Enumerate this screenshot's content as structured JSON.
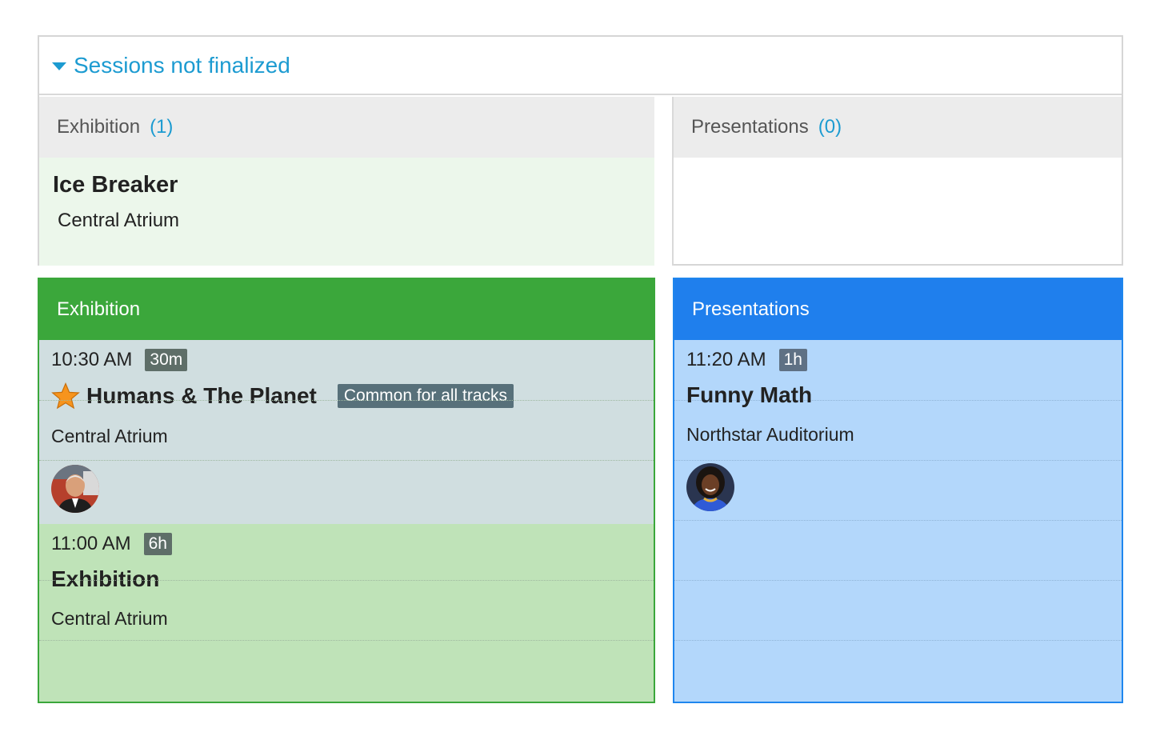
{
  "unfinalized": {
    "title": "Sessions not finalized",
    "tracks": [
      {
        "name": "Exhibition",
        "count": "(1)"
      },
      {
        "name": "Presentations",
        "count": "(0)"
      }
    ],
    "sessions": [
      {
        "title": "Ice Breaker",
        "room": "Central Atrium"
      }
    ]
  },
  "schedule": {
    "tracks": [
      {
        "name": "Exhibition",
        "color": "#3ba73b",
        "sessions": [
          {
            "time": "10:30 AM",
            "duration": "30m",
            "title": "Humans & The Planet",
            "badge": "Common for all tracks",
            "room": "Central Atrium",
            "starred": true,
            "icon": "star-icon"
          },
          {
            "time": "11:00 AM",
            "duration": "6h",
            "title": "Exhibition",
            "room": "Central Atrium"
          }
        ]
      },
      {
        "name": "Presentations",
        "color": "#1f7fed",
        "sessions": [
          {
            "time": "11:20 AM",
            "duration": "1h",
            "title": "Funny Math",
            "room": "Northstar Auditorium"
          }
        ]
      }
    ]
  }
}
